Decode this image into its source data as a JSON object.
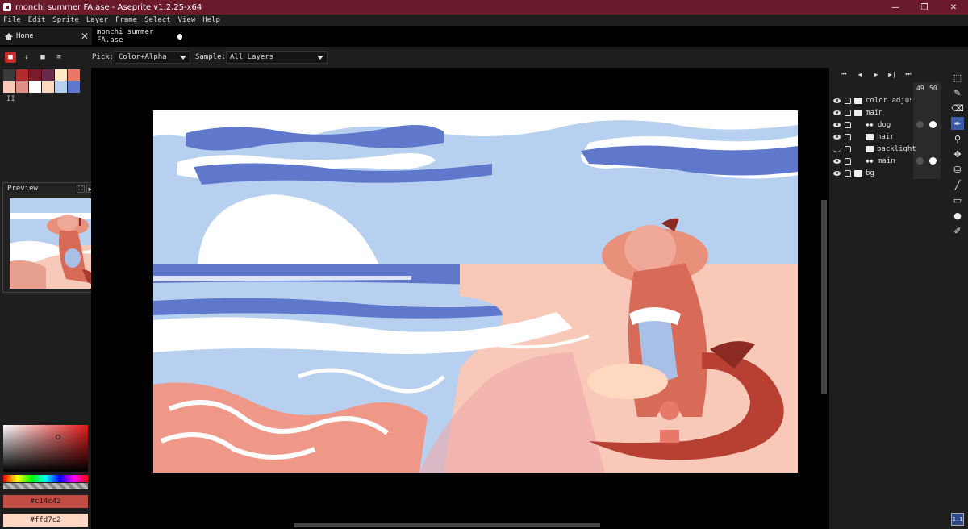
{
  "window": {
    "title": "monchi summer FA.ase - Aseprite v1.2.25-x64",
    "minimize": "—",
    "maximize": "❐",
    "close": "✕"
  },
  "menu": [
    "File",
    "Edit",
    "Sprite",
    "Layer",
    "Frame",
    "Select",
    "View",
    "Help"
  ],
  "tabs": {
    "home_label": "Home",
    "home_close": "✕",
    "file_label": "monchi summer FA.ase"
  },
  "context_bar": {
    "pick_label": "Pick:",
    "pick_value": "Color+Alpha",
    "sample_label": "Sample:",
    "sample_value": "All Layers"
  },
  "palette": [
    "#3a3a3a",
    "#b22c2c",
    "#7a1a2a",
    "#6a2a4a",
    "#ffe8c8",
    "#e8786a",
    "#f8c8b8",
    "#e09088",
    "#ffffff",
    "#ffd8c0",
    "#b8d0f0",
    "#6078cc"
  ],
  "palette_handle": "II",
  "preview": {
    "title": "Preview"
  },
  "colors": {
    "foreground_hex": "#c14c42",
    "background_hex": "#ffd7c2",
    "foreground_color": "#c14c42",
    "background_color": "#ffd7c2"
  },
  "timeline": {
    "controls": [
      "⏮",
      "◀",
      "▶",
      "▶|",
      "⏭"
    ],
    "frame_numbers": [
      "49",
      "50"
    ],
    "layers": [
      {
        "name": "color adjust",
        "visible": true,
        "indent": false,
        "folder": true
      },
      {
        "name": "main",
        "visible": true,
        "indent": false,
        "folder": true
      },
      {
        "name": "dog",
        "visible": true,
        "indent": true,
        "folder": false
      },
      {
        "name": "hair",
        "visible": true,
        "indent": true,
        "folder": true
      },
      {
        "name": "backlight",
        "visible": false,
        "indent": true,
        "folder": true
      },
      {
        "name": "main",
        "visible": true,
        "indent": true,
        "folder": false
      },
      {
        "name": "bg",
        "visible": true,
        "indent": false,
        "folder": true
      }
    ]
  },
  "tools": [
    "rect-select",
    "pencil",
    "eraser",
    "eyedropper",
    "zoom",
    "move",
    "paint-bucket",
    "line",
    "rectangle",
    "blur",
    "contour"
  ],
  "tool_glyphs": [
    "⬚",
    "✎",
    "⌫",
    "✒",
    "⚲",
    "✥",
    "⛁",
    "╱",
    "▭",
    "●",
    "✐"
  ],
  "bottom_button": "1:1"
}
